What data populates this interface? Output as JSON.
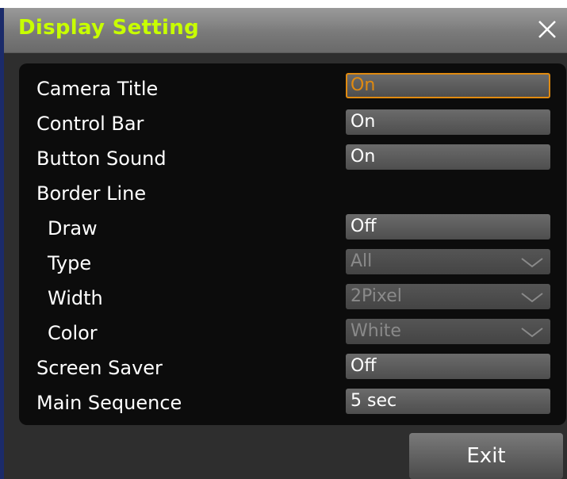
{
  "window": {
    "title": "Display Setting",
    "close_icon": "close-icon"
  },
  "settings": [
    {
      "label": "Camera Title",
      "value": "On",
      "focused": true,
      "disabled": false,
      "dropdown": false
    },
    {
      "label": "Control Bar",
      "value": "On",
      "focused": false,
      "disabled": false,
      "dropdown": false
    },
    {
      "label": "Button Sound",
      "value": "On",
      "focused": false,
      "disabled": false,
      "dropdown": false
    },
    {
      "label": "Border Line",
      "value": null,
      "header": true
    },
    {
      "label": "Draw",
      "value": "Off",
      "focused": false,
      "disabled": false,
      "dropdown": false
    },
    {
      "label": "Type",
      "value": "All",
      "focused": false,
      "disabled": true,
      "dropdown": true
    },
    {
      "label": "Width",
      "value": "2Pixel",
      "focused": false,
      "disabled": true,
      "dropdown": true
    },
    {
      "label": "Color",
      "value": "White",
      "focused": false,
      "disabled": true,
      "dropdown": true
    },
    {
      "label": "Screen Saver",
      "value": "Off",
      "focused": false,
      "disabled": false,
      "dropdown": false
    },
    {
      "label": "Main Sequence",
      "value": "5 sec",
      "focused": false,
      "disabled": false,
      "dropdown": false
    }
  ],
  "footer": {
    "exit_label": "Exit"
  },
  "colors": {
    "title_text": "#c8ff00",
    "focus": "#e08a10",
    "panel": "#0c0c0c"
  }
}
